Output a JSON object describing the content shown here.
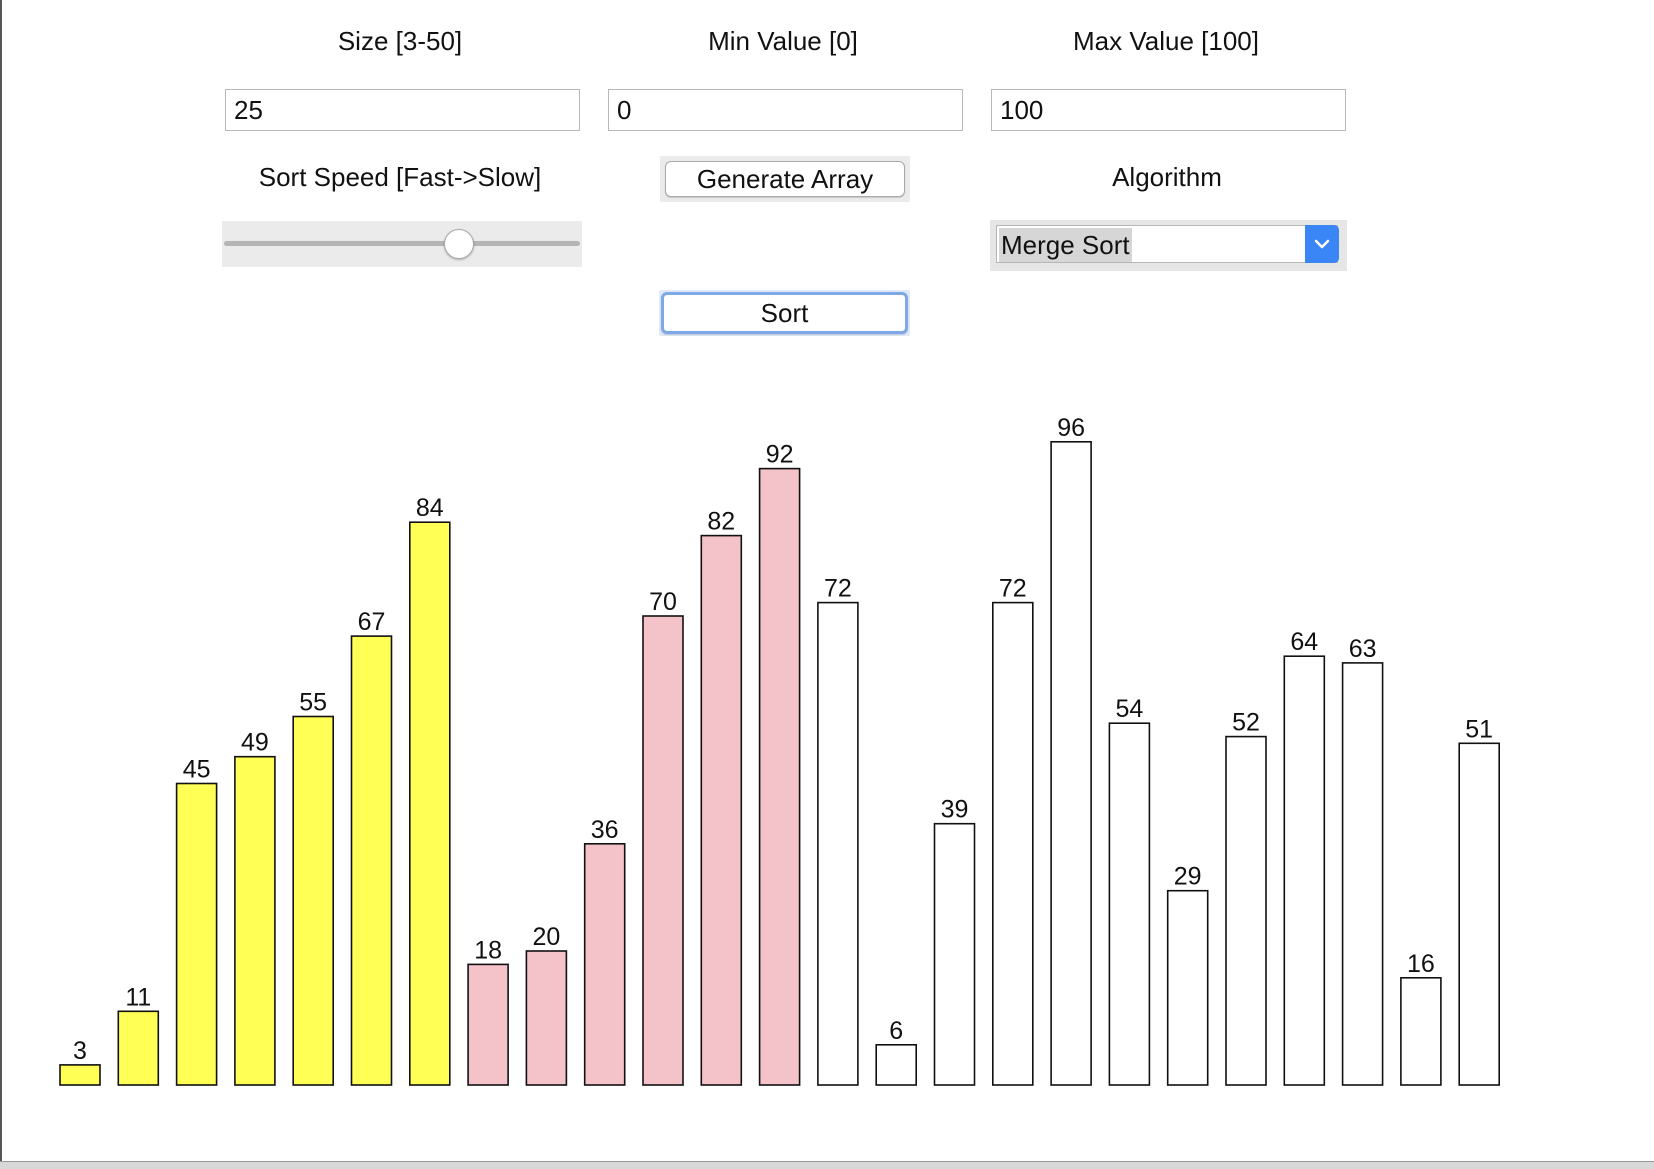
{
  "controls": {
    "size_label": "Size [3-50]",
    "size_value": "25",
    "min_label": "Min Value [0]",
    "min_value": "0",
    "max_label": "Max Value [100]",
    "max_value": "100",
    "speed_label": "Sort Speed [Fast->Slow]",
    "speed_fraction": 0.66,
    "generate_label": "Generate Array",
    "algorithm_label": "Algorithm",
    "algorithm_selected": "Merge Sort",
    "sort_label": "Sort"
  },
  "icons": {
    "dropdown": "chevron-down-icon"
  },
  "colors": {
    "sorted_bar": "#ffff55",
    "active_bar": "#f4c2c9",
    "default_bar": "#ffffff",
    "bar_border": "#111111",
    "focus_ring": "#7ea9e6",
    "select_accent": "#3a86f7"
  },
  "chart_data": {
    "type": "bar",
    "values": [
      3,
      11,
      45,
      49,
      55,
      67,
      84,
      18,
      20,
      36,
      70,
      82,
      92,
      72,
      6,
      39,
      72,
      96,
      54,
      29,
      52,
      64,
      63,
      16,
      51
    ],
    "states": [
      "sorted",
      "sorted",
      "sorted",
      "sorted",
      "sorted",
      "sorted",
      "sorted",
      "active",
      "active",
      "active",
      "active",
      "active",
      "active",
      "default",
      "default",
      "default",
      "default",
      "default",
      "default",
      "default",
      "default",
      "default",
      "default",
      "default",
      "default"
    ],
    "ylim": [
      0,
      100
    ]
  }
}
